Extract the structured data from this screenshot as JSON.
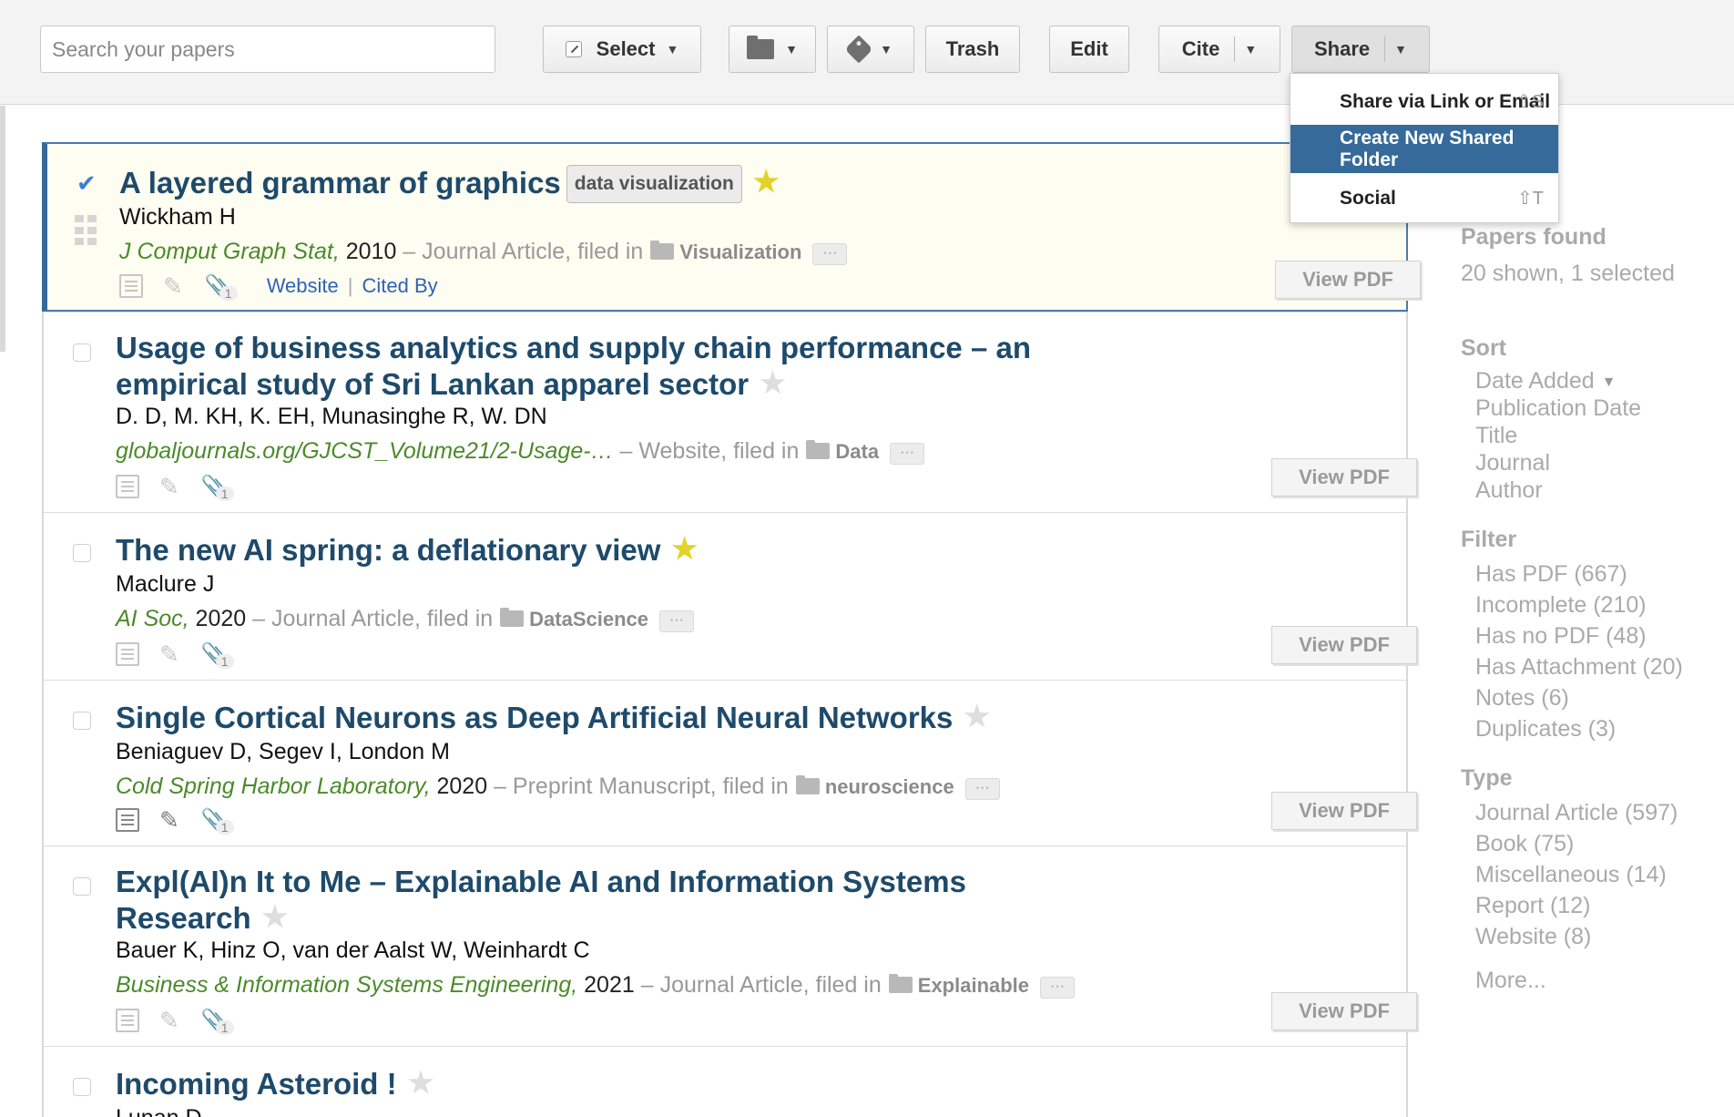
{
  "toolbar": {
    "search_placeholder": "Search your papers",
    "select_label": "Select",
    "trash_label": "Trash",
    "edit_label": "Edit",
    "cite_label": "Cite",
    "share_label": "Share"
  },
  "share_menu": {
    "items": [
      {
        "label": "Share via Link or Email",
        "shortcut": "⇧S"
      },
      {
        "label": "Create New Shared Folder",
        "shortcut": ""
      },
      {
        "label": "Social",
        "shortcut": "⇧T"
      }
    ]
  },
  "papers": [
    {
      "title": "A layered grammar of graphics",
      "tag": "data visualization",
      "starred": true,
      "selected": true,
      "authors": "Wickham H",
      "journal": "J Comput Graph Stat,",
      "year": "2010",
      "type_text": "– Journal Article, filed in",
      "folder": "Visualization",
      "attachments": "1",
      "website_label": "Website",
      "citedby_label": "Cited By",
      "view_pdf": "View PDF"
    },
    {
      "title_line1": "Usage of business analytics and supply chain performance – an",
      "title_line2": "empirical study of Sri Lankan apparel sector",
      "starred": false,
      "authors": "D. D, M. KH, K. EH, Munasinghe R, W. DN",
      "journal": "globaljournals.org/GJCST_Volume21/2-Usage-…",
      "year": "",
      "type_text": "– Website, filed in",
      "folder": "Data",
      "attachments": "1",
      "view_pdf": "View PDF"
    },
    {
      "title": "The new AI spring: a deflationary view",
      "starred": true,
      "authors": "Maclure J",
      "journal": "AI Soc,",
      "year": "2020",
      "type_text": "– Journal Article, filed in",
      "folder": "DataScience",
      "attachments": "1",
      "view_pdf": "View PDF"
    },
    {
      "title": "Single Cortical Neurons as Deep Artificial Neural Networks",
      "starred": false,
      "authors": "Beniaguev D, Segev I, London M",
      "journal": "Cold Spring Harbor Laboratory,",
      "year": "2020",
      "type_text": "– Preprint Manuscript, filed in",
      "folder": "neuroscience",
      "attachments": "1",
      "view_pdf": "View PDF"
    },
    {
      "title_line1": "Expl(AI)n It to Me – Explainable AI and Information Systems",
      "title_line2": "Research",
      "starred": false,
      "authors": "Bauer K, Hinz O, van der Aalst W, Weinhardt C",
      "journal": "Business & Information Systems Engineering,",
      "year": "2021",
      "type_text": "– Journal Article, filed in",
      "folder": "Explainable",
      "attachments": "1",
      "view_pdf": "View PDF"
    },
    {
      "title": "Incoming Asteroid !",
      "starred": false,
      "authors": "Lunan D"
    }
  ],
  "sidebar": {
    "papers_found_heading": "Papers found",
    "papers_found_summary": "20 shown, 1 selected",
    "sort_heading": "Sort",
    "sort_items": [
      "Date Added",
      "Publication Date",
      "Title",
      "Journal",
      "Author"
    ],
    "filter_heading": "Filter",
    "filter_items": [
      "Has PDF (667)",
      "Incomplete (210)",
      "Has no PDF (48)",
      "Has Attachment (20)",
      "Notes (6)",
      "Duplicates (3)"
    ],
    "type_heading": "Type",
    "type_items": [
      "Journal Article (597)",
      "Book (75)",
      "Miscellaneous (14)",
      "Report (12)",
      "Website (8)"
    ],
    "more_label": "More..."
  },
  "colors": {
    "title": "#1e4a6b",
    "journal": "#4b8a2a",
    "selection_accent": "#356a9a",
    "star_on": "#e2d32b"
  }
}
